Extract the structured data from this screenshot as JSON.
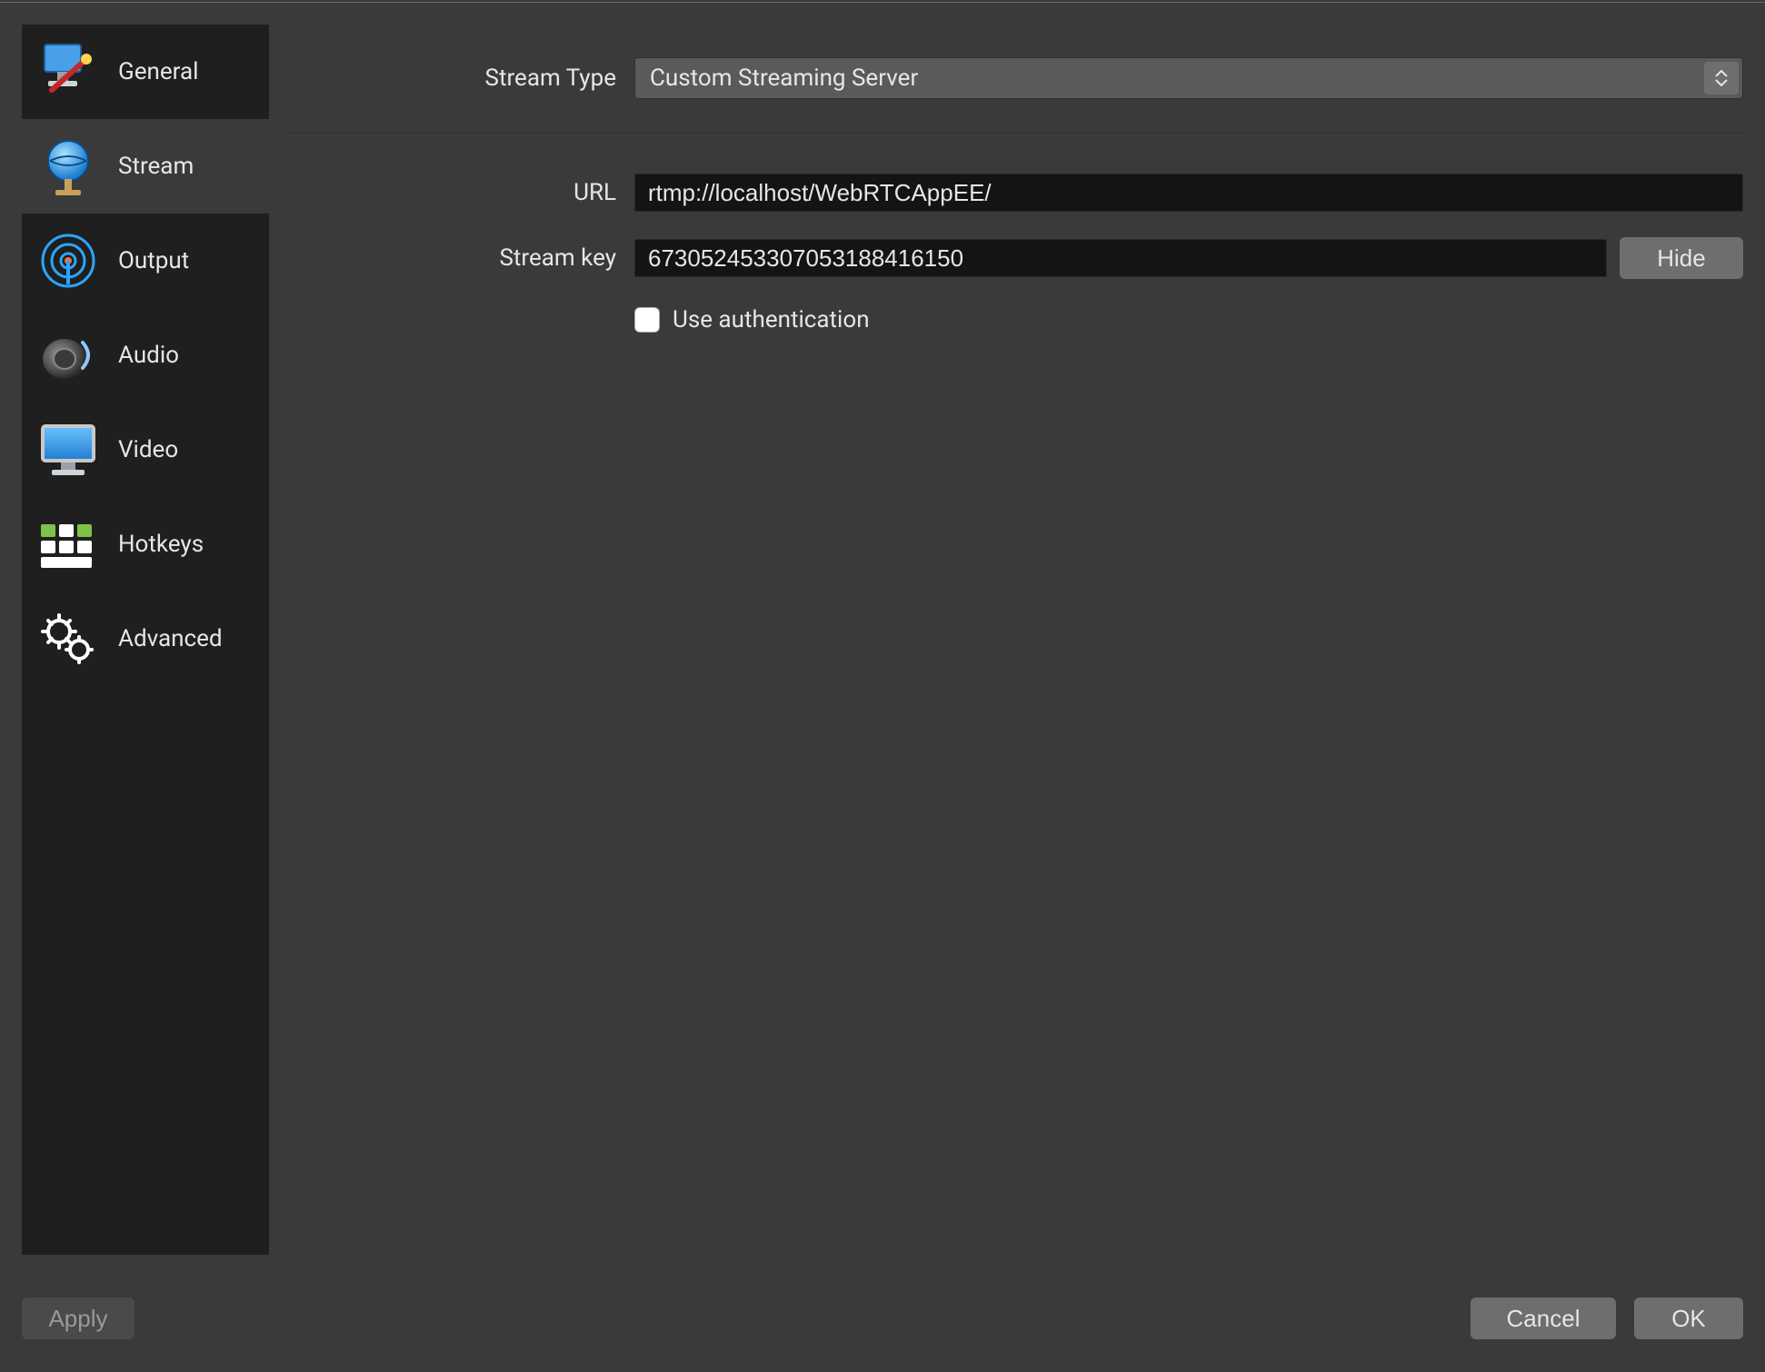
{
  "sidebar": {
    "items": [
      {
        "label": "General",
        "icon": "general"
      },
      {
        "label": "Stream",
        "icon": "stream"
      },
      {
        "label": "Output",
        "icon": "output"
      },
      {
        "label": "Audio",
        "icon": "audio"
      },
      {
        "label": "Video",
        "icon": "video"
      },
      {
        "label": "Hotkeys",
        "icon": "hotkeys"
      },
      {
        "label": "Advanced",
        "icon": "advanced"
      }
    ],
    "selected_index": 1
  },
  "form": {
    "stream_type": {
      "label": "Stream Type",
      "value": "Custom Streaming Server"
    },
    "url": {
      "label": "URL",
      "value": "rtmp://localhost/WebRTCAppEE/"
    },
    "stream_key": {
      "label": "Stream key",
      "value": "673052453307053188416150",
      "hide_button": "Hide"
    },
    "auth": {
      "label": "Use authentication",
      "checked": false
    }
  },
  "footer": {
    "apply": "Apply",
    "cancel": "Cancel",
    "ok": "OK"
  }
}
